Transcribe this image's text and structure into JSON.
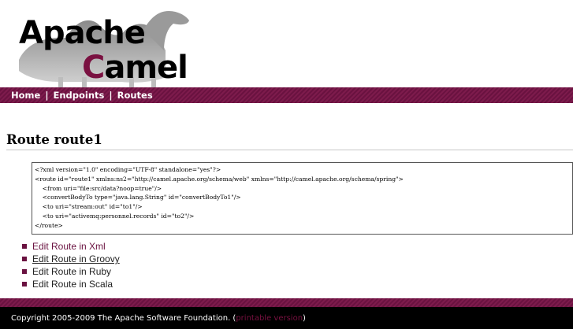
{
  "logo": {
    "word1": "Apache",
    "word2_first": "C",
    "word2_rest": "amel",
    "image": "camel-silhouette-icon"
  },
  "nav": {
    "items": [
      "Home",
      "Endpoints",
      "Routes"
    ],
    "separator": "|"
  },
  "page": {
    "title": "Route route1"
  },
  "xml": {
    "lines": [
      "<?xml version=\"1.0\" encoding=\"UTF-8\" standalone=\"yes\"?>",
      "<route id=\"route1\" xmlns:ns2=\"http://camel.apache.org/schema/web\" xmlns=\"http://camel.apache.org/schema/spring\">",
      "    <from uri=\"file:src/data?noop=true\"/>",
      "    <convertBodyTo type=\"java.lang.String\" id=\"convertBodyTo1\"/>",
      "    <to uri=\"stream:out\" id=\"to1\"/>",
      "    <to uri=\"activemq:personnel.records\" id=\"to2\"/>",
      "</route>"
    ]
  },
  "links": [
    "Edit Route in Xml",
    "Edit Route in Groovy",
    "Edit Route in Ruby",
    "Edit Route in Scala"
  ],
  "footer": {
    "copyright": "Copyright 2005-2009 The Apache Software Foundation. (",
    "link": "printable version",
    "close": ")"
  },
  "colors": {
    "brand": "#7a1141",
    "nav_bg": "#6a1240",
    "footer_bg": "#000000"
  }
}
